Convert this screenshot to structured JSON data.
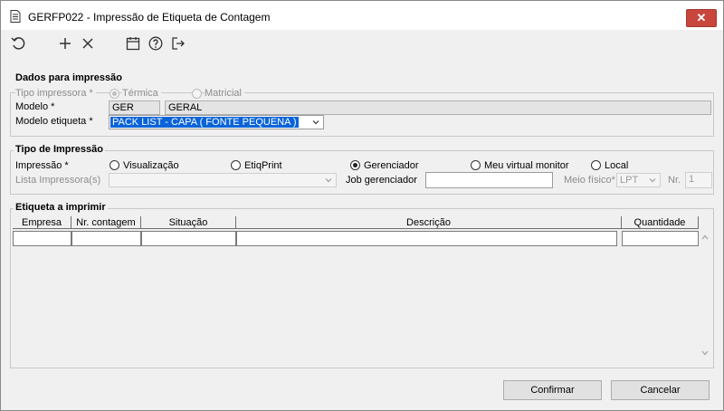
{
  "window": {
    "title": "GERFP022 - Impressão de Etiqueta de Contagem",
    "close": "✕"
  },
  "toolbar": {
    "icons": [
      "refresh-icon",
      "add-icon",
      "delete-icon",
      "calendar-icon",
      "help-icon",
      "exit-icon"
    ]
  },
  "dados": {
    "title": "Dados para impressão",
    "tipo_label": "Tipo impressora *",
    "tipo_options": [
      "Térmica",
      "Matricial"
    ],
    "modelo_label": "Modelo *",
    "modelo_code": "GER",
    "modelo_desc": "GERAL",
    "etiqueta_label": "Modelo etiqueta *",
    "etiqueta_value": "PACK LIST - CAPA ( FONTE PEQUENA )"
  },
  "tipo_impressao": {
    "title": "Tipo de Impressão",
    "impressao_label": "Impressão *",
    "options": [
      "Visualização",
      "EtiqPrint",
      "Gerenciador",
      "Meu virtual monitor",
      "Local"
    ],
    "selected": "Gerenciador",
    "lista_label": "Lista Impressora(s)",
    "job_label": "Job gerenciador",
    "meio_label": "Meio físico*",
    "meio_value": "LPT",
    "nr_label": "Nr.",
    "nr_value": "1"
  },
  "etiqueta": {
    "title": "Etiqueta a imprimir",
    "columns": [
      "Empresa",
      "Nr. contagem",
      "Situação",
      "Descrição",
      "Quantidade"
    ]
  },
  "buttons": {
    "confirmar": "Confirmar",
    "cancelar": "Cancelar"
  }
}
